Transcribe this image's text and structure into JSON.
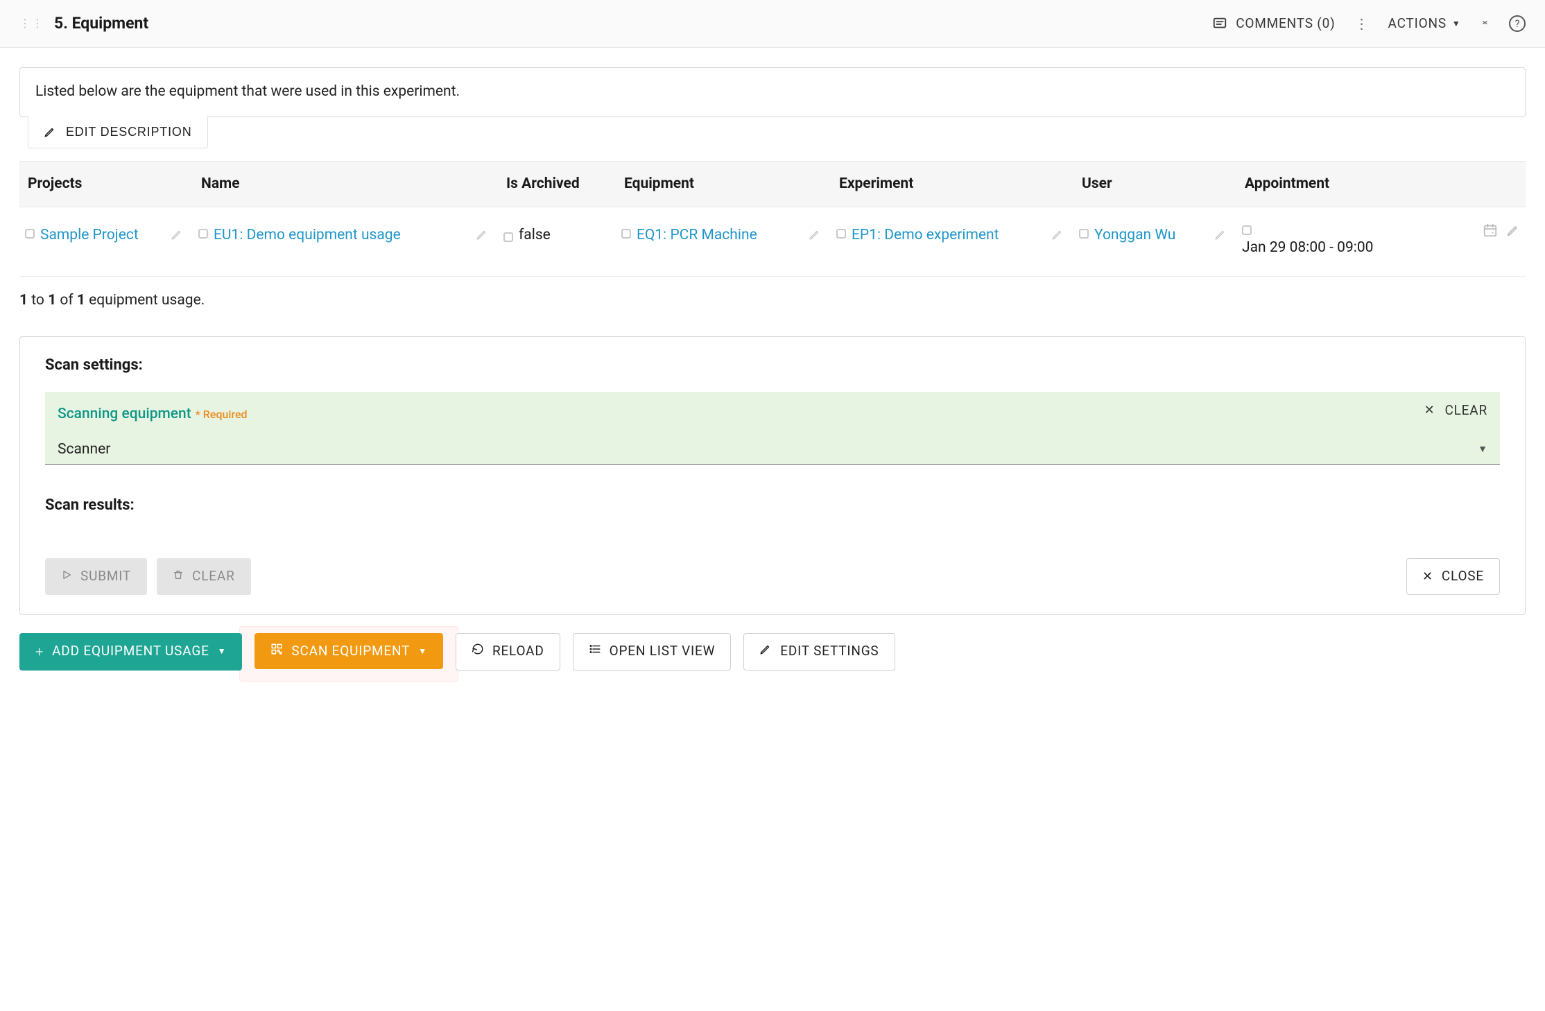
{
  "header": {
    "title": "5. Equipment",
    "comments_label": "COMMENTS (0)",
    "actions_label": "ACTIONS"
  },
  "description": "Listed below are the equipment that were used in this experiment.",
  "edit_description_label": "EDIT DESCRIPTION",
  "columns": {
    "projects": "Projects",
    "name": "Name",
    "is_archived": "Is Archived",
    "equipment": "Equipment",
    "experiment": "Experiment",
    "user": "User",
    "appointment": "Appointment"
  },
  "rows": [
    {
      "project": "Sample Project",
      "name": "EU1: Demo equipment usage",
      "is_archived": "false",
      "equipment": "EQ1: PCR Machine",
      "experiment": "EP1: Demo experiment",
      "user": "Yonggan Wu",
      "appointment": "Jan 29 08:00 - 09:00"
    }
  ],
  "pagination": {
    "from": "1",
    "to": "1",
    "of": "1",
    "suffix": "equipment usage."
  },
  "scan": {
    "settings_heading": "Scan settings:",
    "field_label": "Scanning equipment",
    "required": "* Required",
    "selected": "Scanner",
    "clear_label": "CLEAR",
    "results_heading": "Scan results:"
  },
  "scan_footer": {
    "submit": "SUBMIT",
    "clear": "CLEAR",
    "close": "CLOSE"
  },
  "action_bar": {
    "add": "ADD EQUIPMENT USAGE",
    "scan": "SCAN EQUIPMENT",
    "reload": "RELOAD",
    "open_list": "OPEN LIST VIEW",
    "edit_settings": "EDIT SETTINGS"
  }
}
